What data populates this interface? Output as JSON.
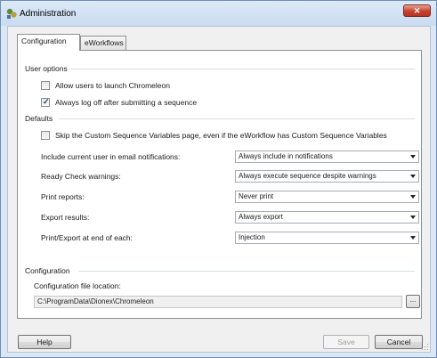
{
  "window": {
    "title": "Administration",
    "app_icon": "administration-app-icon",
    "close_icon": "close-icon"
  },
  "tabs": [
    {
      "label": "Configuration",
      "active": true
    },
    {
      "label": "eWorkflows",
      "active": false
    }
  ],
  "user_options": {
    "heading": "User options",
    "allow_launch": {
      "label": "Allow users to launch Chromeleon",
      "checked": false
    },
    "always_logoff": {
      "label": "Always log off after submitting a sequence",
      "checked": true
    }
  },
  "defaults": {
    "heading": "Defaults",
    "skip_custom": {
      "label": "Skip the Custom Sequence Variables page, even if the eWorkflow has Custom Sequence Variables",
      "checked": false
    },
    "fields": [
      {
        "label": "Include current user in email notifications:",
        "value": "Always include in notifications"
      },
      {
        "label": "Ready Check warnings:",
        "value": "Always execute sequence despite warnings"
      },
      {
        "label": "Print reports:",
        "value": "Never print"
      },
      {
        "label": "Export results:",
        "value": "Always export"
      },
      {
        "label": "Print/Export at end of each:",
        "value": "Injection"
      }
    ]
  },
  "configuration": {
    "heading": "Configuration",
    "file_location_label": "Configuration file location:",
    "file_location_value": "C:\\ProgramData\\Dionex\\Chromeleon",
    "browse_label": "..."
  },
  "buttons": {
    "help": "Help",
    "save": "Save",
    "cancel": "Cancel"
  },
  "colors": {
    "title_bar": "#c9dcf1",
    "close_button": "#c7412d",
    "group_line": "#d5dfe5"
  }
}
